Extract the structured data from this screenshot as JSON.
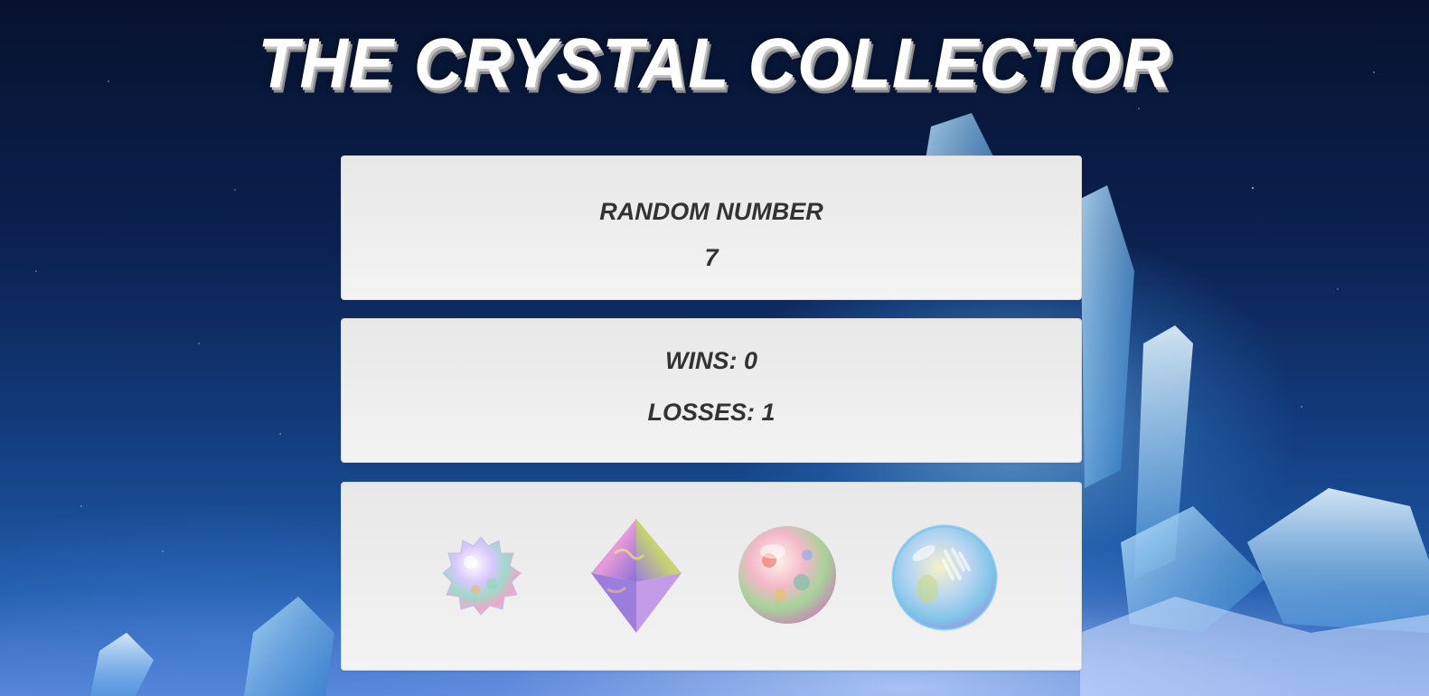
{
  "title": "THE CRYSTAL COLLECTOR",
  "random_number": {
    "label": "RANDOM NUMBER",
    "value": "7"
  },
  "score": {
    "wins_label": "WINS:",
    "wins_value": "0",
    "losses_label": "LOSSES:",
    "losses_value": "1"
  },
  "crystals": [
    {
      "name": "crystal-1",
      "icon": "spiky-crystal-ball-icon"
    },
    {
      "name": "crystal-2",
      "icon": "octahedron-crystal-icon"
    },
    {
      "name": "crystal-3",
      "icon": "opal-sphere-icon"
    },
    {
      "name": "crystal-4",
      "icon": "iridescent-bubble-sphere-icon"
    }
  ],
  "colors": {
    "panel_bg": "#f0f0f0",
    "text": "#333333",
    "title": "#ffffff",
    "background_dark": "#07122e",
    "background_light": "#5f88d8"
  }
}
